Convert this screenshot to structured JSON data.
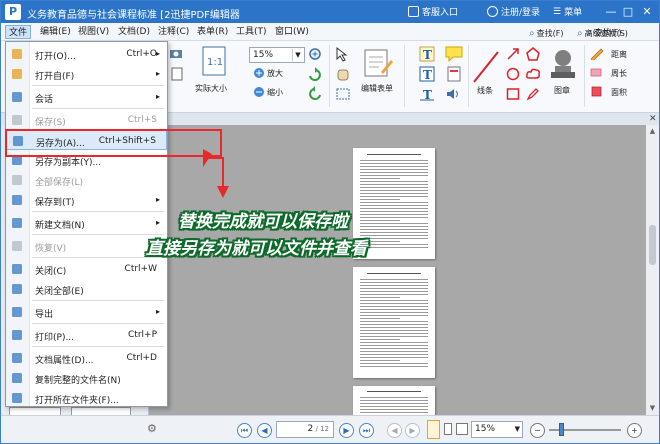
{
  "window": {
    "logo": "P",
    "title": "义务教育品德与社会课程标准 [2迅捷PDF编辑器",
    "service": "客服入口",
    "account": "注册/登录",
    "menu_label": "菜单"
  },
  "menubar": [
    "文件",
    "编辑(E)",
    "视图(V)",
    "文档(D)",
    "注释(C)",
    "表单(R)",
    "工具(T)",
    "窗口(W)"
  ],
  "ribbon": {
    "zoom_value": "15%",
    "actual_size": "实际大小",
    "zoom_in": "放大",
    "zoom_out": "缩小",
    "edit_form": "编辑表单",
    "line": "线条",
    "stamp": "图章",
    "find": "查找(F)",
    "advanced_find": "高级查找(S)",
    "distance": "距离",
    "perimeter": "周长",
    "area": "面积"
  },
  "file_menu": [
    {
      "label": "打开(O)...",
      "shortcut": "Ctrl+O",
      "submenu": true,
      "disabled": false
    },
    {
      "label": "打开自(F)",
      "shortcut": "",
      "submenu": true,
      "disabled": false
    },
    {
      "sep": true
    },
    {
      "label": "会话",
      "shortcut": "",
      "submenu": true,
      "disabled": false
    },
    {
      "sep": true
    },
    {
      "label": "保存(S)",
      "shortcut": "Ctrl+S",
      "submenu": false,
      "disabled": true
    },
    {
      "label": "另存为(A)...",
      "shortcut": "Ctrl+Shift+S",
      "submenu": false,
      "disabled": false,
      "highlight": true
    },
    {
      "label": "另存为副本(Y)...",
      "shortcut": "",
      "submenu": false,
      "disabled": false
    },
    {
      "label": "全部保存(L)",
      "shortcut": "",
      "submenu": false,
      "disabled": true
    },
    {
      "label": "保存到(T)",
      "shortcut": "",
      "submenu": true,
      "disabled": false
    },
    {
      "sep": true
    },
    {
      "label": "新建文档(N)",
      "shortcut": "",
      "submenu": true,
      "disabled": false
    },
    {
      "sep": true
    },
    {
      "label": "恢复(V)",
      "shortcut": "",
      "submenu": false,
      "disabled": true
    },
    {
      "sep": true
    },
    {
      "label": "关闭(C)",
      "shortcut": "Ctrl+W",
      "submenu": false,
      "disabled": false
    },
    {
      "label": "关闭全部(E)",
      "shortcut": "",
      "submenu": false,
      "disabled": false
    },
    {
      "sep": true
    },
    {
      "label": "导出",
      "shortcut": "",
      "submenu": true,
      "disabled": false
    },
    {
      "sep": true
    },
    {
      "label": "打印(P)...",
      "shortcut": "Ctrl+P",
      "submenu": false,
      "disabled": false
    },
    {
      "sep": true
    },
    {
      "label": "文档属性(D)...",
      "shortcut": "Ctrl+D",
      "submenu": false,
      "disabled": false
    },
    {
      "label": "复制完整的文件名(N)",
      "shortcut": "",
      "submenu": false,
      "disabled": false
    },
    {
      "label": "打开所在文件夹(F)...",
      "shortcut": "",
      "submenu": false,
      "disabled": false
    }
  ],
  "annotation": {
    "line1": "替换完成就可以保存啦",
    "line2": "直接另存为就可以文件并查看",
    "box_color": "#e8282b",
    "text_outline": "#0d6b2a"
  },
  "status": {
    "page_current": "2",
    "page_total": "12",
    "zoom": "15%"
  },
  "colors": {
    "titlebar": "#2b74c8",
    "accent": "#4a87c9"
  }
}
